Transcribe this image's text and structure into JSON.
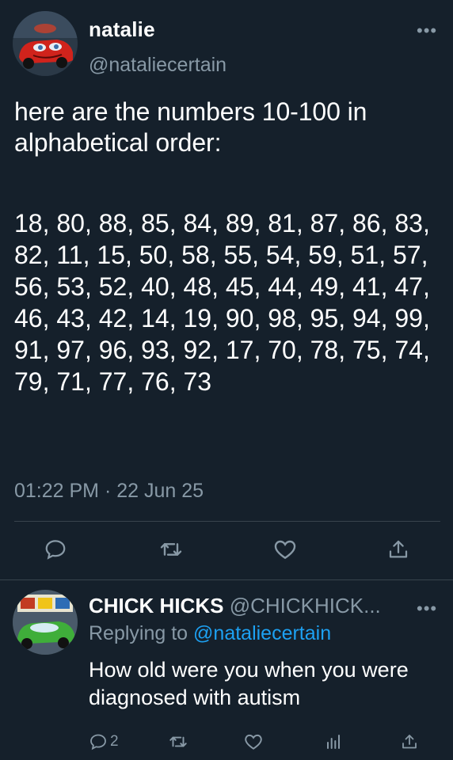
{
  "tweet": {
    "author_name": "natalie",
    "author_handle": "@nataliecertain",
    "more_label": "•••",
    "text_intro": "here are the numbers 10-100 in alphabetical order:",
    "text_numbers": "18, 80, 88, 85, 84, 89, 81, 87, 86, 83, 82, 11, 15, 50, 58, 55, 54, 59, 51, 57, 56, 53, 52, 40, 48, 45, 44, 49, 41, 47, 46, 43, 42, 14, 19, 90, 98, 95, 94, 99, 91, 97, 96, 93, 92, 17, 70, 78, 75, 74, 79, 71, 77, 76, 73",
    "timestamp": "01:22 PM · 22 Jun 25",
    "actions": [
      "reply-icon",
      "retweet-icon",
      "like-icon",
      "share-icon"
    ]
  },
  "reply": {
    "author_name": "CHICK HICKS",
    "author_handle": "@CHICKHICK...",
    "more_label": "•••",
    "replying_prefix": "Replying to ",
    "replying_to": "@nataliecertain",
    "text": "How old were you when you were diagnosed with autism",
    "reply_count": "2",
    "actions": [
      "reply-icon",
      "retweet-icon",
      "like-icon",
      "analytics-icon",
      "share-icon"
    ]
  },
  "colors": {
    "background": "#15202b",
    "text": "#ffffff",
    "muted": "#8899a6",
    "link": "#1da1f2",
    "divider": "#38444d"
  }
}
